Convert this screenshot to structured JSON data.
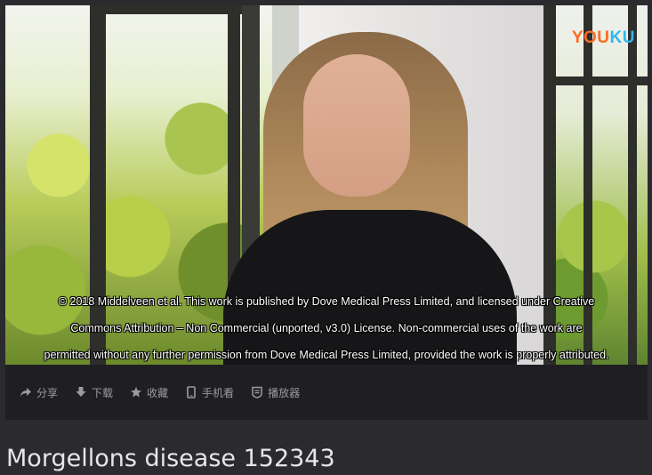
{
  "logo": {
    "part1": "YOU",
    "part2": "KU"
  },
  "captions": [
    "© 2018 Middelveen et al. This work is published by Dove Medical Press Limited, and licensed under Creative",
    "Commons Attribution – Non Commercial (unported, v3.0) License. Non-commercial uses of the work are",
    "permitted without any further permission from Dove Medical Press Limited, provided the work is properly attributed."
  ],
  "toolbar": {
    "share": "分享",
    "download": "下载",
    "favorite": "收藏",
    "mobile": "手机看",
    "player": "播放器"
  },
  "title": "Morgellons disease 152343",
  "colors": {
    "accent_orange": "#ff6a21",
    "accent_blue": "#32b6ef",
    "toolbar_text": "#9a9aa0"
  }
}
